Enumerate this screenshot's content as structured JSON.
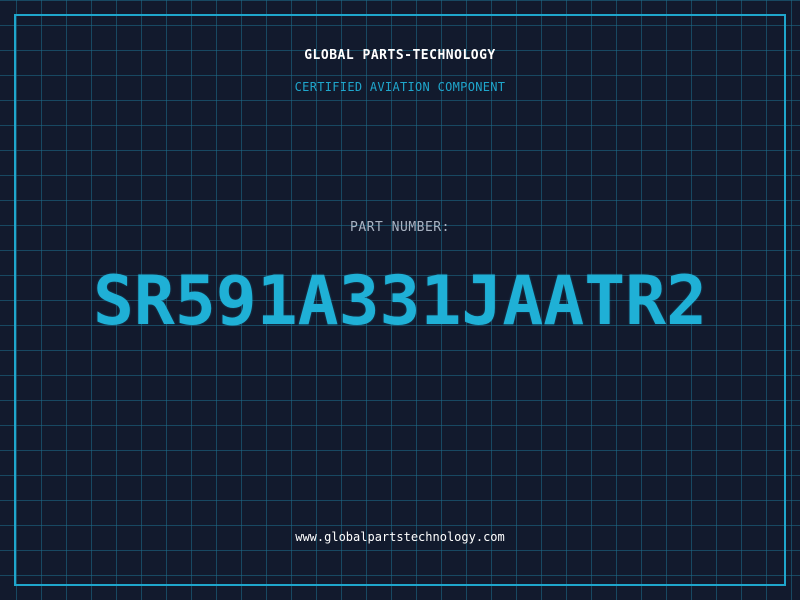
{
  "header": {
    "company": "GLOBAL PARTS-TECHNOLOGY",
    "tagline": "CERTIFIED AVIATION COMPONENT"
  },
  "part": {
    "label": "PART NUMBER:",
    "number": "SR591A331JAATR2"
  },
  "footer": {
    "website": "www.globalpartstechnology.com"
  },
  "colors": {
    "background": "#121a2d",
    "accent": "#1fb0d6",
    "grid": "#1e6e8c",
    "text": "#ffffff",
    "muted": "#a9b3c2"
  }
}
